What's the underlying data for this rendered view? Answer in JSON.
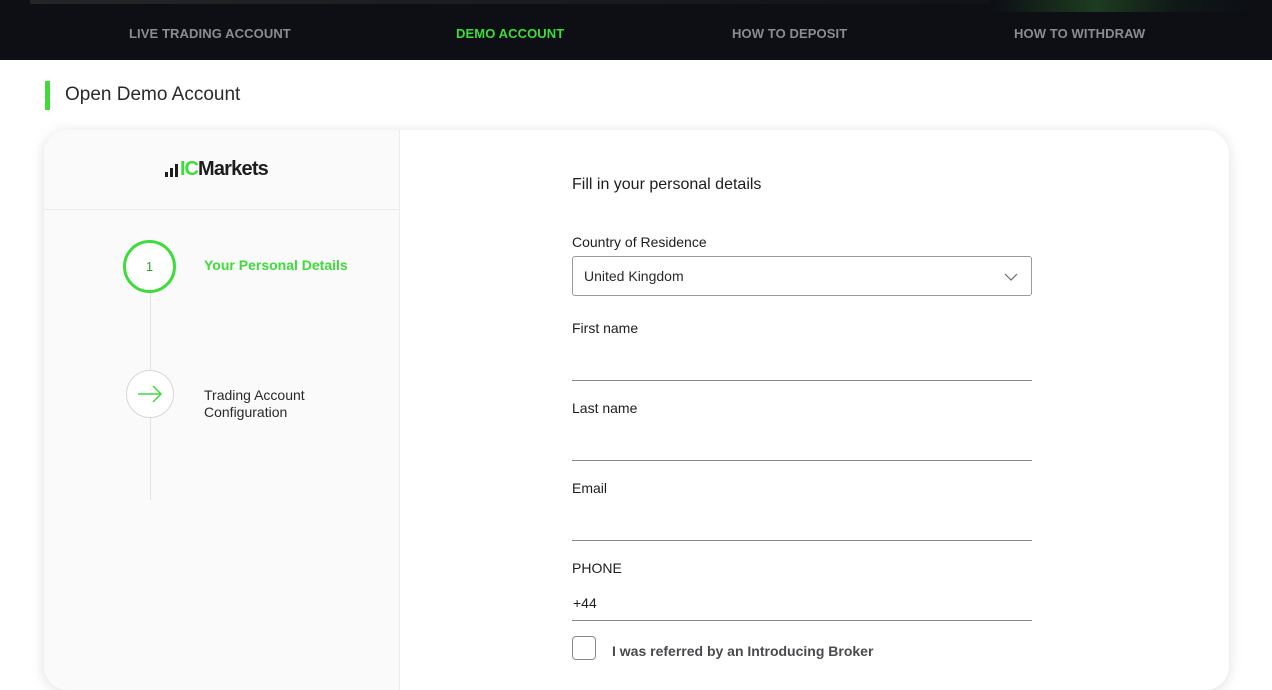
{
  "nav": {
    "items": [
      {
        "label": "LIVE TRADING ACCOUNT",
        "active": false
      },
      {
        "label": "DEMO ACCOUNT",
        "active": true
      },
      {
        "label": "HOW TO DEPOSIT",
        "active": false
      },
      {
        "label": "HOW TO WITHDRAW",
        "active": false
      }
    ]
  },
  "page": {
    "title": "Open Demo Account"
  },
  "brand": {
    "logo_ic": "IC",
    "logo_markets": "Markets",
    "accent_color": "#3ddc3a"
  },
  "steps": [
    {
      "number": "1",
      "label": "Your Personal Details",
      "state": "current"
    },
    {
      "icon": "arrow-right-icon",
      "label": "Trading Account Configuration",
      "state": "upcoming"
    }
  ],
  "form": {
    "heading": "Fill in your personal details",
    "country": {
      "label": "Country of Residence",
      "value": "United Kingdom"
    },
    "first_name": {
      "label": "First name",
      "value": ""
    },
    "last_name": {
      "label": "Last name",
      "value": ""
    },
    "email": {
      "label": "Email",
      "value": ""
    },
    "phone": {
      "label": "PHONE",
      "value": "+44"
    },
    "referral": {
      "label": "I was referred by an Introducing Broker",
      "checked": false
    }
  }
}
